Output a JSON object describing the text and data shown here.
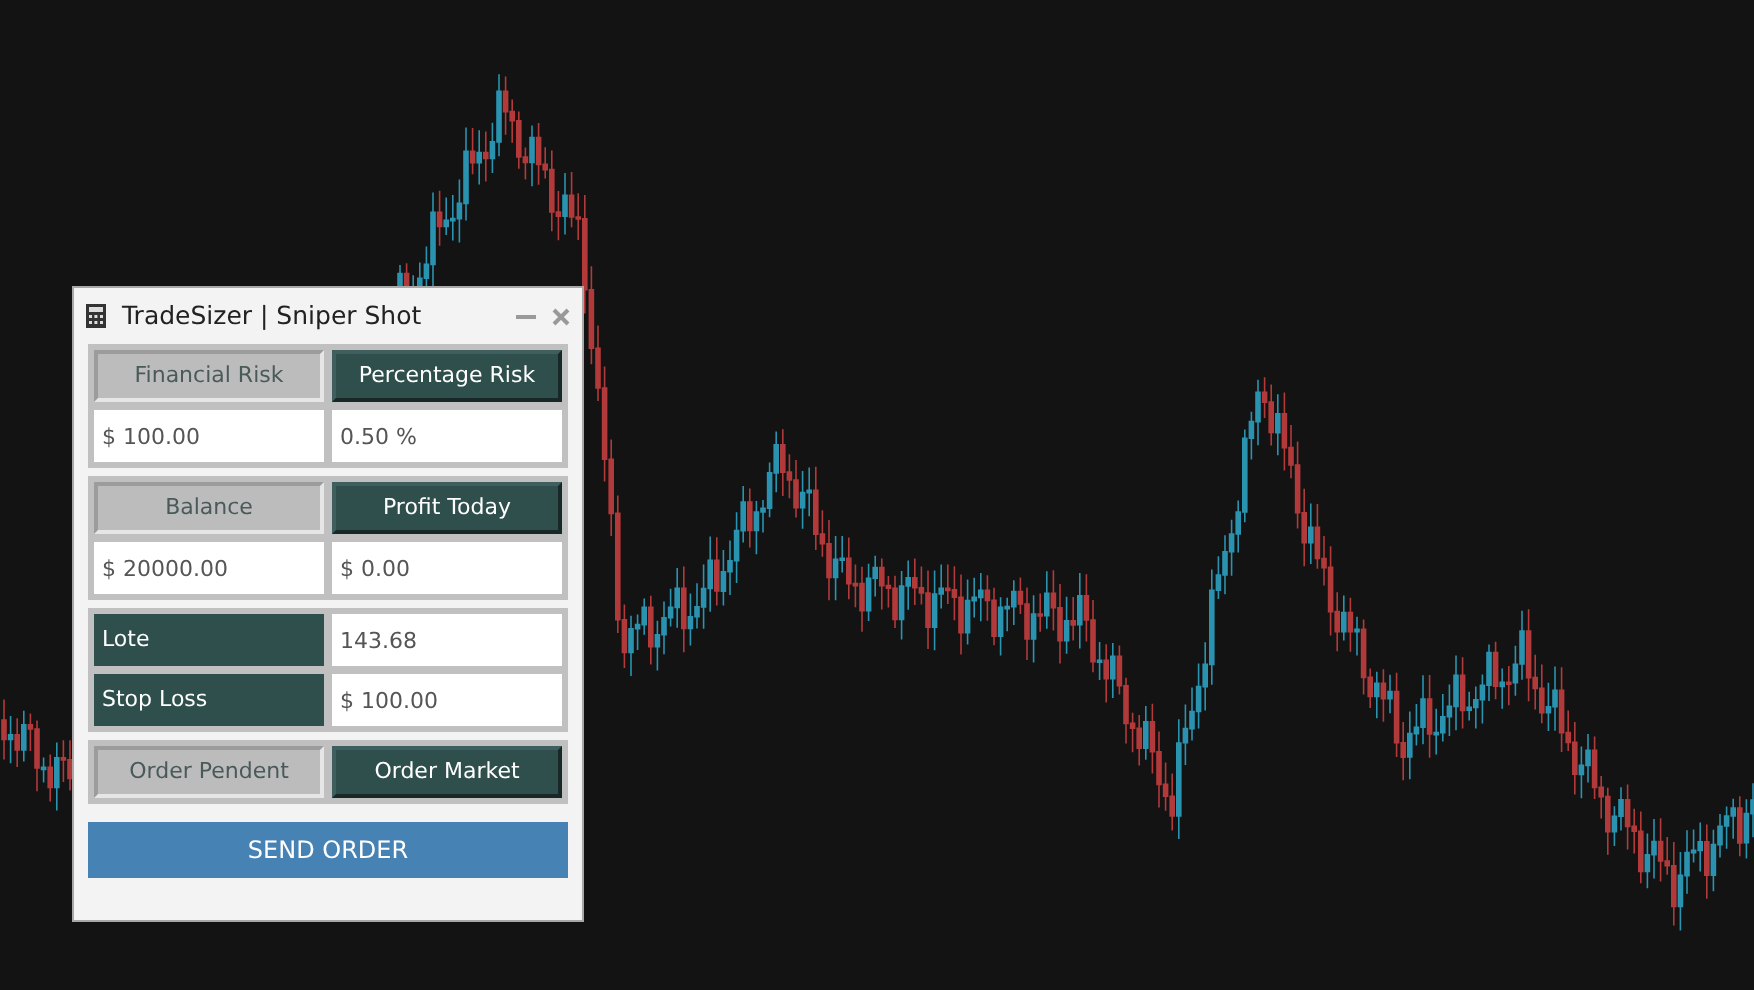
{
  "window": {
    "title": "TradeSizer | Sniper Shot"
  },
  "sections": [
    {
      "kind": "toggle",
      "options": [
        {
          "label": "Financial Risk",
          "selected": false
        },
        {
          "label": "Percentage Risk",
          "selected": true
        }
      ],
      "fields": [
        {
          "value": "$ 100.00"
        },
        {
          "value": "0.50 %"
        }
      ]
    },
    {
      "kind": "toggle",
      "options": [
        {
          "label": "Balance",
          "selected": false
        },
        {
          "label": "Profit Today",
          "selected": true
        }
      ],
      "fields": [
        {
          "value": "$ 20000.00"
        },
        {
          "value": "$ 0.00"
        }
      ]
    },
    {
      "kind": "labeled",
      "rows": [
        {
          "label": "Lote",
          "value": "143.68"
        },
        {
          "label": "Stop Loss",
          "value": "$ 100.00"
        }
      ]
    },
    {
      "kind": "toggle",
      "options": [
        {
          "label": "Order Pendent",
          "selected": false
        },
        {
          "label": "Order Market",
          "selected": true
        }
      ]
    }
  ],
  "send_button": "SEND ORDER"
}
